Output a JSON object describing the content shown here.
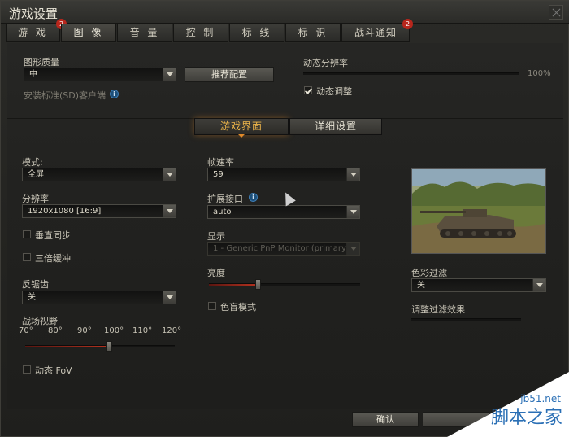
{
  "window": {
    "title": "游戏设置"
  },
  "tabs": [
    {
      "label": "游 戏",
      "badge": "2"
    },
    {
      "label": "图 像",
      "active": true
    },
    {
      "label": "音 量"
    },
    {
      "label": "控 制"
    },
    {
      "label": "标 线"
    },
    {
      "label": "标 识"
    },
    {
      "label": "战斗通知",
      "badge": "2"
    }
  ],
  "graphics": {
    "quality_label": "图形质量",
    "quality_value": "中",
    "recommend_button": "推荐配置",
    "sd_client_label": "安装标准(SD)客户端",
    "dynamic_res_label": "动态分辨率",
    "dynamic_res_value": "100%",
    "dynamic_adjust_label": "动态调整",
    "dynamic_adjust_checked": true
  },
  "subtabs": {
    "interface": "游戏界面",
    "details": "详细设置"
  },
  "left": {
    "mode_label": "模式:",
    "mode_value": "全屏",
    "resolution_label": "分辨率",
    "resolution_value": "1920x1080 [16:9]",
    "vsync_label": "垂直同步",
    "triple_buffer_label": "三倍缓冲",
    "aa_label": "反锯齿",
    "aa_value": "关",
    "fov_label": "战场视野",
    "fov_ticks": [
      "70°",
      "80°",
      "90°",
      "100°",
      "110°",
      "120°"
    ],
    "fov_level": 0.56,
    "dynamic_fov_label": "动态 FoV"
  },
  "middle": {
    "fps_label": "帧速率",
    "fps_value": "59",
    "ext_label": "扩展接口",
    "ext_value": "auto",
    "display_label": "显示",
    "display_value": "1 - Generic PnP Monitor (primary)",
    "brightness_label": "亮度",
    "brightness_level": 0.32,
    "colorblind_label": "色盲模式"
  },
  "right": {
    "color_filter_label": "色彩过滤",
    "color_filter_value": "关",
    "filter_effect_label": "调整过滤效果"
  },
  "footer": {
    "confirm": "确认"
  },
  "watermark": {
    "site": "jb51.net",
    "name": "脚本之家"
  }
}
